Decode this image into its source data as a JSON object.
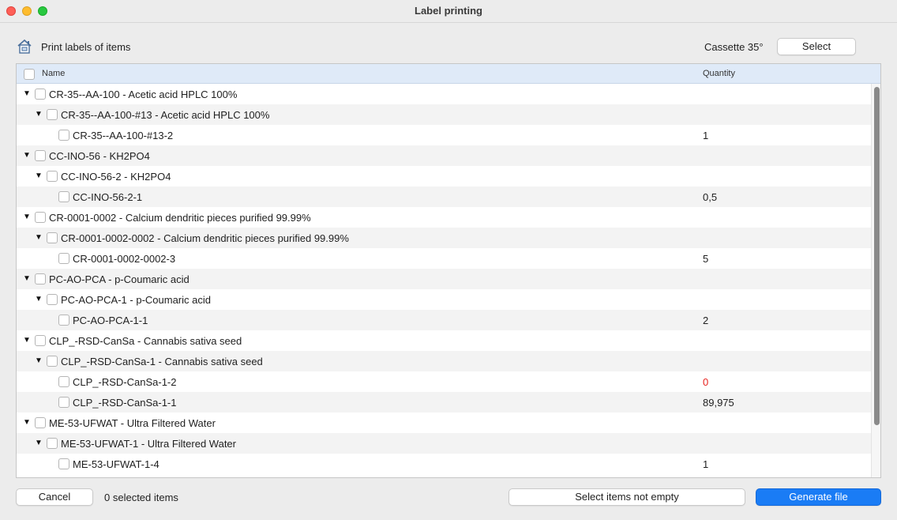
{
  "window": {
    "title": "Label printing"
  },
  "header": {
    "title": "Print labels of items",
    "cassette_label": "Cassette 35°",
    "select_label": "Select"
  },
  "table": {
    "columns": {
      "name": "Name",
      "quantity": "Quantity"
    },
    "rows": [
      {
        "level": 0,
        "expanded": true,
        "label": "CR-35--AA-100 - Acetic acid HPLC 100%",
        "quantity": ""
      },
      {
        "level": 1,
        "expanded": true,
        "label": "CR-35--AA-100-#13 - Acetic acid HPLC 100%",
        "quantity": ""
      },
      {
        "level": 2,
        "expanded": false,
        "label": "CR-35--AA-100-#13-2",
        "quantity": "1"
      },
      {
        "level": 0,
        "expanded": true,
        "label": "CC-INO-56 - KH2PO4",
        "quantity": ""
      },
      {
        "level": 1,
        "expanded": true,
        "label": "CC-INO-56-2 - KH2PO4",
        "quantity": ""
      },
      {
        "level": 2,
        "expanded": false,
        "label": "CC-INO-56-2-1",
        "quantity": "0,5"
      },
      {
        "level": 0,
        "expanded": true,
        "label": "CR-0001-0002 - Calcium dendritic pieces purified 99.99%",
        "quantity": ""
      },
      {
        "level": 1,
        "expanded": true,
        "label": "CR-0001-0002-0002 - Calcium dendritic pieces purified 99.99%",
        "quantity": ""
      },
      {
        "level": 2,
        "expanded": false,
        "label": "CR-0001-0002-0002-3",
        "quantity": "5"
      },
      {
        "level": 0,
        "expanded": true,
        "label": "PC-AO-PCA - p-Coumaric acid",
        "quantity": ""
      },
      {
        "level": 1,
        "expanded": true,
        "label": "PC-AO-PCA-1 - p-Coumaric acid",
        "quantity": ""
      },
      {
        "level": 2,
        "expanded": false,
        "label": "PC-AO-PCA-1-1",
        "quantity": "2"
      },
      {
        "level": 0,
        "expanded": true,
        "label": "CLP_-RSD-CanSa - Cannabis sativa seed",
        "quantity": ""
      },
      {
        "level": 1,
        "expanded": true,
        "label": "CLP_-RSD-CanSa-1 - Cannabis sativa seed",
        "quantity": ""
      },
      {
        "level": 2,
        "expanded": false,
        "label": "CLP_-RSD-CanSa-1-2",
        "quantity": "0",
        "zero": true
      },
      {
        "level": 2,
        "expanded": false,
        "label": "CLP_-RSD-CanSa-1-1",
        "quantity": "89,975"
      },
      {
        "level": 0,
        "expanded": true,
        "label": "ME-53-UFWAT - Ultra Filtered Water",
        "quantity": ""
      },
      {
        "level": 1,
        "expanded": true,
        "label": "ME-53-UFWAT-1 - Ultra Filtered Water",
        "quantity": ""
      },
      {
        "level": 2,
        "expanded": false,
        "label": "ME-53-UFWAT-1-4",
        "quantity": "1"
      }
    ]
  },
  "footer": {
    "cancel_label": "Cancel",
    "selected_count": "0 selected items",
    "select_not_empty_label": "Select items not empty",
    "generate_label": "Generate file"
  },
  "colors": {
    "accent": "#1a7cf5",
    "header_bg": "#dfeaf8",
    "zero_quantity": "#e8231f"
  },
  "icons": {
    "header_icon": "home-label-icon",
    "expand": "triangle-down-icon"
  }
}
